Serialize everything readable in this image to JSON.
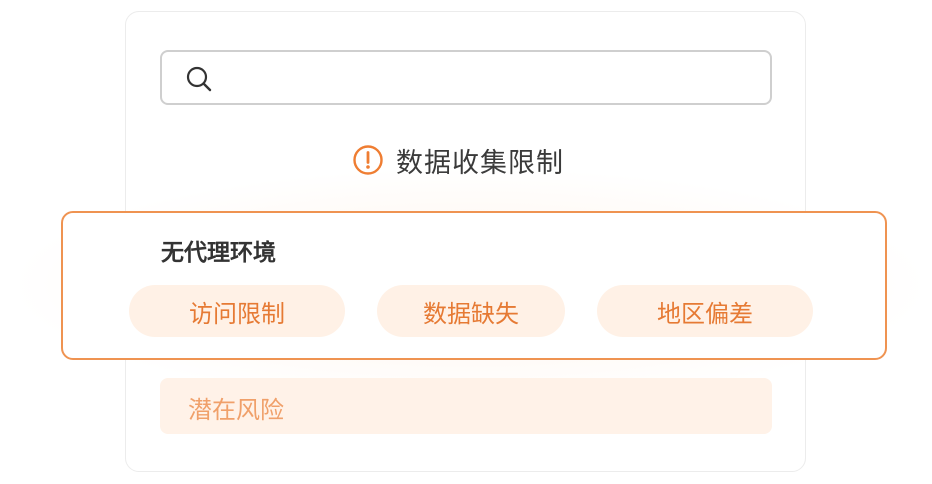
{
  "search": {
    "placeholder": "",
    "value": "",
    "icon": "search-icon"
  },
  "heading": {
    "icon": "alert-circle-icon",
    "text": "数据收集限制"
  },
  "panel": {
    "title": "无代理环境",
    "chips": [
      {
        "label": "访问限制"
      },
      {
        "label": "数据缺失"
      },
      {
        "label": "地区偏差"
      }
    ]
  },
  "risk": {
    "label": "潜在风险"
  },
  "colors": {
    "accent": "#ef9351",
    "chip_bg": "#fff1e6",
    "chip_text": "#e67a34",
    "risk_bg": "#fff2e8",
    "risk_text": "#f0a06a",
    "border_gray": "#cfcfcf"
  }
}
